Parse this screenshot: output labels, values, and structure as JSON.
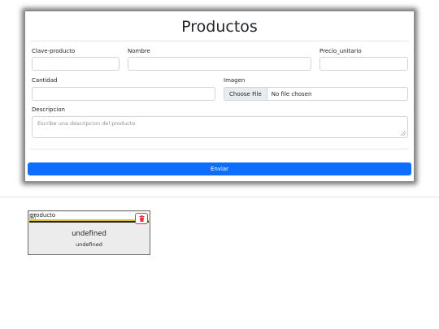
{
  "form": {
    "title": "Productos",
    "labels": {
      "clave": "Clave-producto",
      "nombre": "Nombre",
      "precio": "Precio_unitario",
      "cantidad": "Cantidad",
      "imagen": "Imagen",
      "descripcion": "Descripcion"
    },
    "values": {
      "clave": "",
      "nombre": "",
      "precio": "",
      "cantidad": ""
    },
    "file_button": "Choose File",
    "file_status": "No file chosen",
    "descripcion_placeholder": "Escribe una descripcion del producto",
    "submit_label": "Enviar"
  },
  "product_card": {
    "image_alt": "producto",
    "name": "undefined",
    "description": "undefined",
    "delete_icon": "trash-icon"
  },
  "colors": {
    "primary": "#0d6efd",
    "danger": "#dc3545"
  }
}
